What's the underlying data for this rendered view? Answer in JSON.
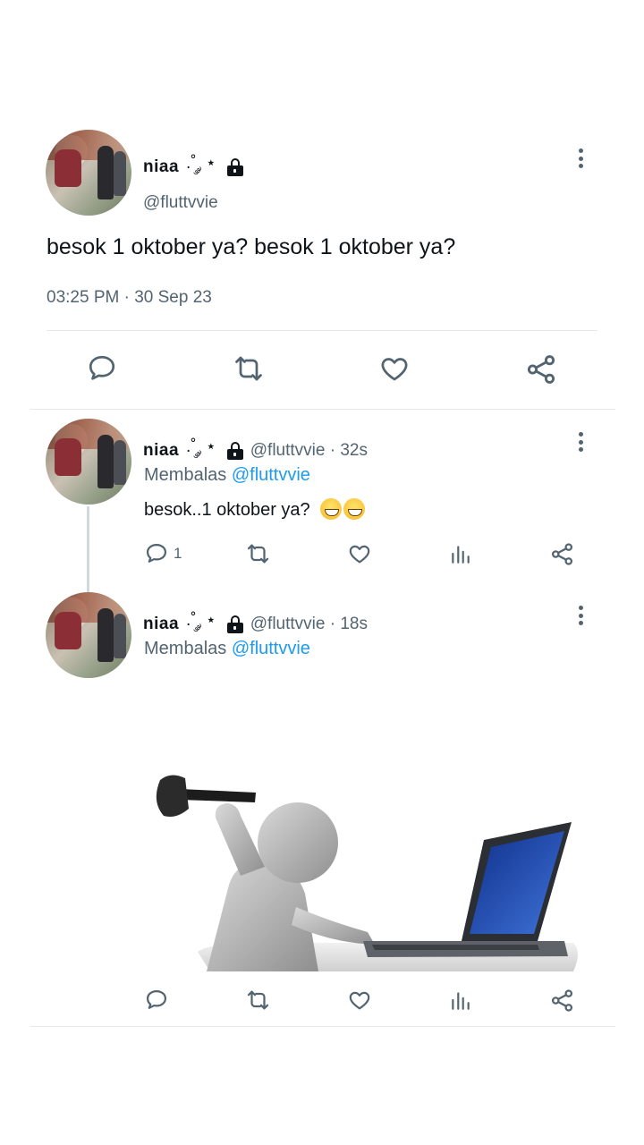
{
  "main_tweet": {
    "display_name": "niaa",
    "name_decoration": ".˚ ༘ ⋆",
    "handle": "@fluttvvie",
    "text": "besok 1 oktober ya? besok 1 oktober ya?",
    "meta": "03:25 PM · 30 Sep 23"
  },
  "reply1": {
    "display_name": "niaa",
    "name_decoration": ".˚ ༘ ⋆",
    "handle_time": "@fluttvvie · 32s",
    "replying_label": "Membalas",
    "replying_mention": "@fluttvvie",
    "text": "besok..1 oktober ya?",
    "reply_count": "1"
  },
  "reply2": {
    "display_name": "niaa",
    "name_decoration": ".˚ ༘ ⋆",
    "handle_time": "@fluttvvie · 18s",
    "replying_label": "Membalas",
    "replying_mention": "@fluttvvie",
    "media_description_icon": "figure-smashing-laptop-image"
  },
  "icons": {
    "reply": "reply-icon",
    "retweet": "retweet-icon",
    "like": "like-icon",
    "share": "share-icon",
    "views": "views-icon",
    "more": "more-icon",
    "lock": "lock-icon"
  },
  "colors": {
    "text": "#0f1419",
    "muted": "#536471",
    "link": "#1d9bf0",
    "divider": "#e6e9eb"
  }
}
